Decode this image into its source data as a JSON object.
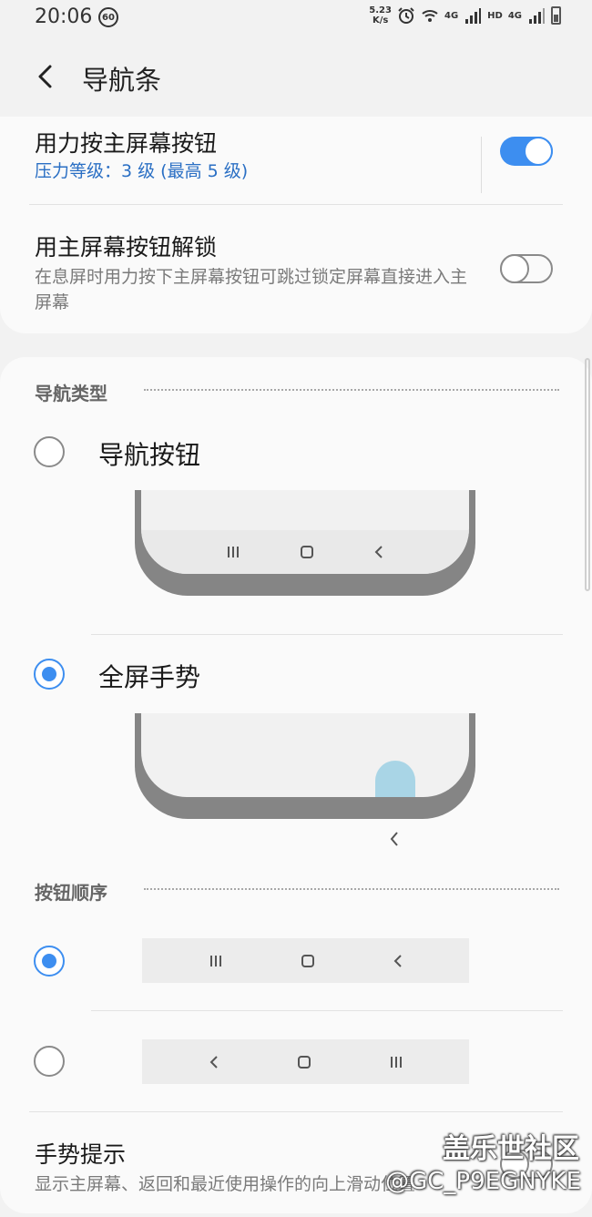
{
  "status_bar": {
    "time": "20:06",
    "badge": "60",
    "net_speed_value": "5.23",
    "net_speed_unit": "K/s",
    "sim1_label": "4G",
    "hd_label": "HD",
    "sim2_label": "4G"
  },
  "header": {
    "title": "导航条"
  },
  "settings": {
    "press_home": {
      "title": "用力按主屏幕按钮",
      "subtitle": "压力等级：3 级 (最高 5 级)",
      "enabled": true
    },
    "unlock_home": {
      "title": "用主屏幕按钮解锁",
      "subtitle": "在息屏时用力按下主屏幕按钮可跳过锁定屏幕直接进入主屏幕",
      "enabled": false
    }
  },
  "nav_type": {
    "header": "导航类型",
    "options": [
      {
        "label": "导航按钮",
        "selected": false
      },
      {
        "label": "全屏手势",
        "selected": true
      }
    ]
  },
  "button_order": {
    "header": "按钮顺序",
    "options": [
      {
        "selected": true,
        "icons": [
          "recents-icon",
          "home-icon",
          "back-icon"
        ]
      },
      {
        "selected": false,
        "icons": [
          "back-icon",
          "home-icon",
          "recents-icon"
        ]
      }
    ]
  },
  "gesture_hint": {
    "title": "手势提示",
    "subtitle": "显示主屏幕、返回和最近使用操作的向上滑动位置",
    "enabled": false
  },
  "watermark": {
    "line1": "盖乐世社区",
    "line2": "@GC_P9EGNYKE"
  },
  "colors": {
    "accent": "#3d8ef0",
    "gesture_blob": "#a9d5e6",
    "link_text": "#2a6fc4"
  }
}
